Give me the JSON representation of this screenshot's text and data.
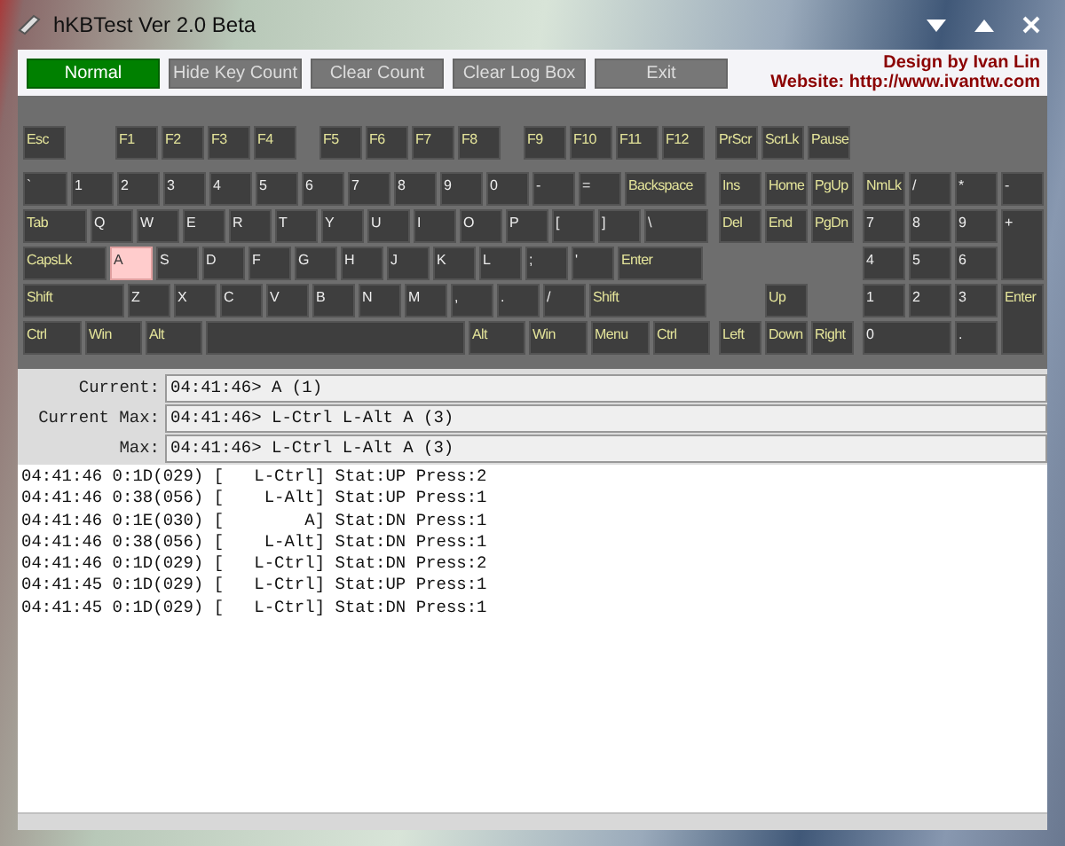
{
  "window": {
    "title": "hKBTest Ver 2.0 Beta"
  },
  "toolbar": {
    "buttons": [
      {
        "label": "Normal",
        "selected": true,
        "disabled": false
      },
      {
        "label": "Hide Key Count",
        "selected": false,
        "disabled": true
      },
      {
        "label": "Clear Count",
        "selected": false,
        "disabled": true
      },
      {
        "label": "Clear Log Box",
        "selected": false,
        "disabled": true
      },
      {
        "label": "Exit",
        "selected": false,
        "disabled": true
      }
    ],
    "credits": [
      "Design by Ivan Lin",
      "Website: http://www.ivantw.com"
    ]
  },
  "keyboard": {
    "function_row": [
      {
        "label": "Esc",
        "kind": "fn",
        "pressed": false
      },
      {
        "label": "F1",
        "kind": "fn",
        "pressed": false
      },
      {
        "label": "F2",
        "kind": "fn",
        "pressed": false
      },
      {
        "label": "F3",
        "kind": "fn",
        "pressed": false
      },
      {
        "label": "F4",
        "kind": "fn",
        "pressed": false
      },
      {
        "label": "F5",
        "kind": "fn",
        "pressed": false
      },
      {
        "label": "F6",
        "kind": "fn",
        "pressed": false
      },
      {
        "label": "F7",
        "kind": "fn",
        "pressed": false
      },
      {
        "label": "F8",
        "kind": "fn",
        "pressed": false
      },
      {
        "label": "F9",
        "kind": "fn",
        "pressed": false
      },
      {
        "label": "F10",
        "kind": "fn",
        "pressed": false
      },
      {
        "label": "F11",
        "kind": "fn",
        "pressed": false
      },
      {
        "label": "F12",
        "kind": "fn",
        "pressed": false
      },
      {
        "label": "PrScr",
        "kind": "fn",
        "pressed": false
      },
      {
        "label": "ScrLk",
        "kind": "fn",
        "pressed": false
      },
      {
        "label": "Pause",
        "kind": "fn",
        "pressed": false
      }
    ],
    "main_rows": [
      [
        {
          "label": "`",
          "kind": "char",
          "pressed": false
        },
        {
          "label": "1",
          "kind": "char",
          "pressed": false
        },
        {
          "label": "2",
          "kind": "char",
          "pressed": false
        },
        {
          "label": "3",
          "kind": "char",
          "pressed": false
        },
        {
          "label": "4",
          "kind": "char",
          "pressed": false
        },
        {
          "label": "5",
          "kind": "char",
          "pressed": false
        },
        {
          "label": "6",
          "kind": "char",
          "pressed": false
        },
        {
          "label": "7",
          "kind": "char",
          "pressed": false
        },
        {
          "label": "8",
          "kind": "char",
          "pressed": false
        },
        {
          "label": "9",
          "kind": "char",
          "pressed": false
        },
        {
          "label": "0",
          "kind": "char",
          "pressed": false
        },
        {
          "label": "-",
          "kind": "char",
          "pressed": false
        },
        {
          "label": "=",
          "kind": "char",
          "pressed": false
        },
        {
          "label": "Backspace",
          "kind": "fn",
          "pressed": false
        }
      ],
      [
        {
          "label": "Tab",
          "kind": "fn",
          "pressed": false
        },
        {
          "label": "Q",
          "kind": "char",
          "pressed": false
        },
        {
          "label": "W",
          "kind": "char",
          "pressed": false
        },
        {
          "label": "E",
          "kind": "char",
          "pressed": false
        },
        {
          "label": "R",
          "kind": "char",
          "pressed": false
        },
        {
          "label": "T",
          "kind": "char",
          "pressed": false
        },
        {
          "label": "Y",
          "kind": "char",
          "pressed": false
        },
        {
          "label": "U",
          "kind": "char",
          "pressed": false
        },
        {
          "label": "I",
          "kind": "char",
          "pressed": false
        },
        {
          "label": "O",
          "kind": "char",
          "pressed": false
        },
        {
          "label": "P",
          "kind": "char",
          "pressed": false
        },
        {
          "label": "[",
          "kind": "char",
          "pressed": false
        },
        {
          "label": "]",
          "kind": "char",
          "pressed": false
        },
        {
          "label": "\\",
          "kind": "char",
          "pressed": false
        }
      ],
      [
        {
          "label": "CapsLk",
          "kind": "fn",
          "pressed": false
        },
        {
          "label": "A",
          "kind": "char",
          "pressed": true
        },
        {
          "label": "S",
          "kind": "char",
          "pressed": false
        },
        {
          "label": "D",
          "kind": "char",
          "pressed": false
        },
        {
          "label": "F",
          "kind": "char",
          "pressed": false
        },
        {
          "label": "G",
          "kind": "char",
          "pressed": false
        },
        {
          "label": "H",
          "kind": "char",
          "pressed": false
        },
        {
          "label": "J",
          "kind": "char",
          "pressed": false
        },
        {
          "label": "K",
          "kind": "char",
          "pressed": false
        },
        {
          "label": "L",
          "kind": "char",
          "pressed": false
        },
        {
          "label": ";",
          "kind": "char",
          "pressed": false
        },
        {
          "label": "'",
          "kind": "char",
          "pressed": false
        },
        {
          "label": "Enter",
          "kind": "fn",
          "pressed": false
        }
      ],
      [
        {
          "label": "Shift",
          "kind": "fn",
          "pressed": false
        },
        {
          "label": "Z",
          "kind": "char",
          "pressed": false
        },
        {
          "label": "X",
          "kind": "char",
          "pressed": false
        },
        {
          "label": "C",
          "kind": "char",
          "pressed": false
        },
        {
          "label": "V",
          "kind": "char",
          "pressed": false
        },
        {
          "label": "B",
          "kind": "char",
          "pressed": false
        },
        {
          "label": "N",
          "kind": "char",
          "pressed": false
        },
        {
          "label": "M",
          "kind": "char",
          "pressed": false
        },
        {
          "label": ",",
          "kind": "char",
          "pressed": false
        },
        {
          "label": ".",
          "kind": "char",
          "pressed": false
        },
        {
          "label": "/",
          "kind": "char",
          "pressed": false
        },
        {
          "label": "Shift",
          "kind": "fn",
          "pressed": false
        }
      ],
      [
        {
          "label": "Ctrl",
          "kind": "fn",
          "pressed": false
        },
        {
          "label": "Win",
          "kind": "fn",
          "pressed": false
        },
        {
          "label": "Alt",
          "kind": "fn",
          "pressed": false
        },
        {
          "kind": "fn",
          "pressed": false
        },
        {
          "label": "Alt",
          "kind": "fn",
          "pressed": false
        },
        {
          "label": "Win",
          "kind": "fn",
          "pressed": false
        },
        {
          "label": "Menu",
          "kind": "fn",
          "pressed": false
        },
        {
          "label": "Ctrl",
          "kind": "fn",
          "pressed": false
        }
      ]
    ],
    "nav_keys": [
      {
        "label": "Ins",
        "kind": "fn",
        "pressed": false
      },
      {
        "label": "Home",
        "kind": "fn",
        "pressed": false
      },
      {
        "label": "PgUp",
        "kind": "fn",
        "pressed": false
      },
      {
        "label": "Del",
        "kind": "fn",
        "pressed": false
      },
      {
        "label": "End",
        "kind": "fn",
        "pressed": false
      },
      {
        "label": "PgDn",
        "kind": "fn",
        "pressed": false
      },
      {
        "label": "Up",
        "kind": "fn",
        "pressed": false
      },
      {
        "label": "Left",
        "kind": "fn",
        "pressed": false
      },
      {
        "label": "Down",
        "kind": "fn",
        "pressed": false
      },
      {
        "label": "Right",
        "kind": "fn",
        "pressed": false
      }
    ],
    "numpad": [
      {
        "label": "NmLk",
        "kind": "fn",
        "pressed": false
      },
      {
        "label": "/",
        "kind": "char",
        "pressed": false
      },
      {
        "label": "*",
        "kind": "char",
        "pressed": false
      },
      {
        "label": "-",
        "kind": "char",
        "pressed": false
      },
      {
        "label": "7",
        "kind": "char",
        "pressed": false
      },
      {
        "label": "8",
        "kind": "char",
        "pressed": false
      },
      {
        "label": "9",
        "kind": "char",
        "pressed": false
      },
      {
        "label": "+",
        "kind": "char",
        "pressed": false
      },
      {
        "label": "4",
        "kind": "char",
        "pressed": false
      },
      {
        "label": "5",
        "kind": "char",
        "pressed": false
      },
      {
        "label": "6",
        "kind": "char",
        "pressed": false
      },
      {
        "label": "1",
        "kind": "char",
        "pressed": false
      },
      {
        "label": "2",
        "kind": "char",
        "pressed": false
      },
      {
        "label": "3",
        "kind": "char",
        "pressed": false
      },
      {
        "label": "Enter",
        "kind": "fn",
        "pressed": false
      },
      {
        "label": "0",
        "kind": "char",
        "pressed": false
      },
      {
        "label": ".",
        "kind": "char",
        "pressed": false
      }
    ]
  },
  "readouts": [
    {
      "label": "Current:",
      "value": "04:41:46> A (1)"
    },
    {
      "label": "Current Max:",
      "value": "04:41:46> L-Ctrl L-Alt A (3)"
    },
    {
      "label": "Max:",
      "value": "04:41:46> L-Ctrl L-Alt A (3)"
    }
  ],
  "log": [
    "04:41:46 0:1D(029) [   L-Ctrl] Stat:UP Press:2",
    "04:41:46 0:38(056) [    L-Alt] Stat:UP Press:1",
    "04:41:46 0:1E(030) [        A] Stat:DN Press:1",
    "04:41:46 0:38(056) [    L-Alt] Stat:DN Press:1",
    "04:41:46 0:1D(029) [   L-Ctrl] Stat:DN Press:2",
    "04:41:45 0:1D(029) [   L-Ctrl] Stat:UP Press:1",
    "04:41:45 0:1D(029) [   L-Ctrl] Stat:DN Press:1"
  ]
}
